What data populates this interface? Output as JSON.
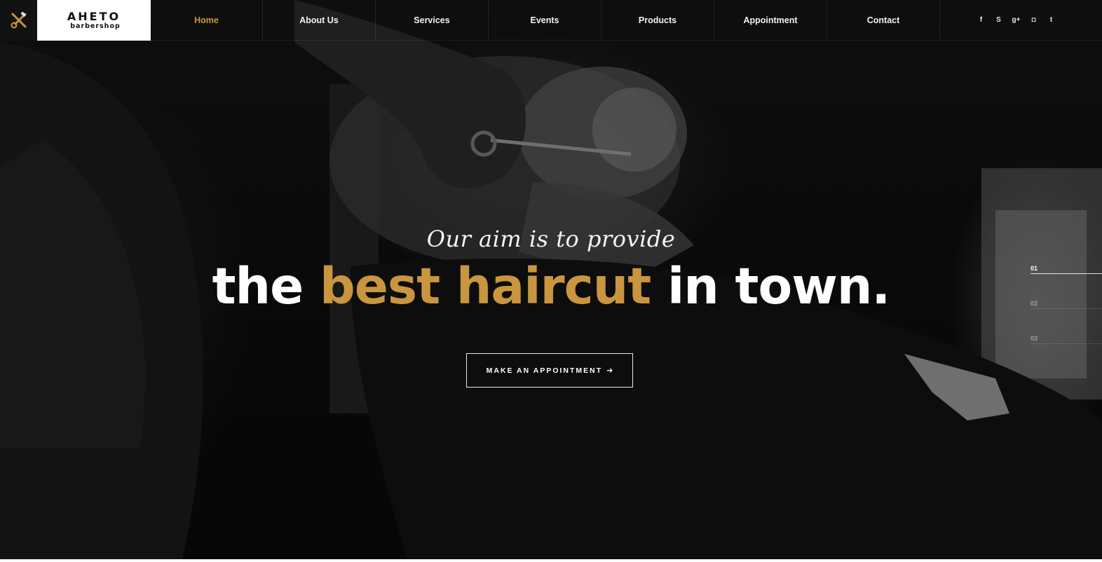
{
  "brand": {
    "name": "AHETO",
    "subtitle": "barbershop",
    "logo_icon": "scissors-razor-icon",
    "accent_color": "#c9963f"
  },
  "nav": {
    "items": [
      {
        "label": "Home",
        "active": true
      },
      {
        "label": "About Us"
      },
      {
        "label": "Services"
      },
      {
        "label": "Events"
      },
      {
        "label": "Products"
      },
      {
        "label": "Appointment"
      },
      {
        "label": "Contact"
      }
    ]
  },
  "social": [
    {
      "icon": "facebook-icon",
      "glyph": "f"
    },
    {
      "icon": "skype-icon",
      "glyph": "S"
    },
    {
      "icon": "google-plus-icon",
      "glyph": "g+"
    },
    {
      "icon": "instagram-icon",
      "glyph": "◘"
    },
    {
      "icon": "twitter-icon",
      "glyph": "t"
    }
  ],
  "hero": {
    "tagline": "Our aim is to provide",
    "headline_start": "the ",
    "headline_accent": "best haircut",
    "headline_end": " in town.",
    "cta_label": "MAKE AN APPOINTMENT",
    "cta_arrow": "➜"
  },
  "slider": {
    "items": [
      "01",
      "02",
      "03"
    ],
    "active_index": 0
  }
}
